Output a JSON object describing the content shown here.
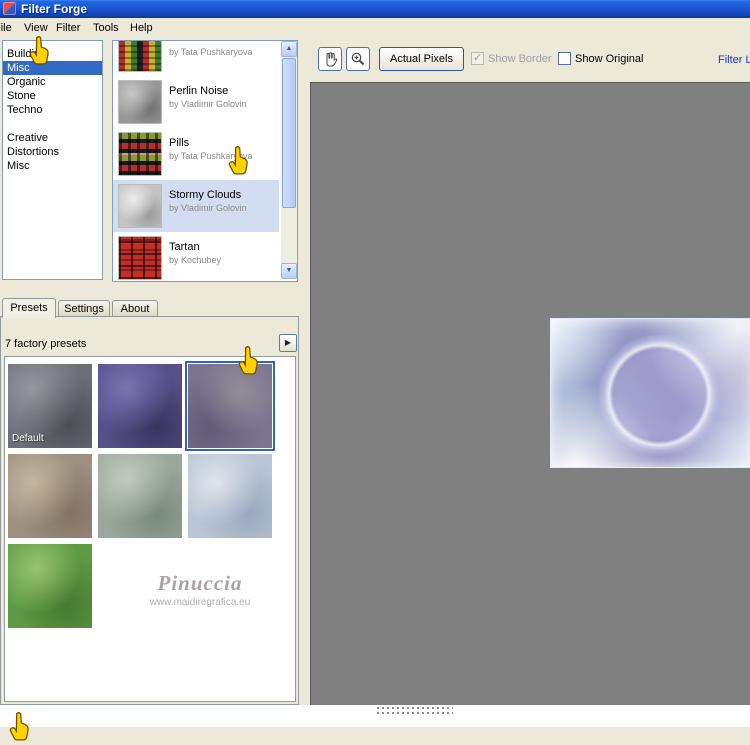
{
  "window": {
    "title": "Filter Forge"
  },
  "menu": {
    "items": [
      "File",
      "View",
      "Filter",
      "Tools",
      "Help"
    ]
  },
  "sidebar": {
    "categories": [
      "Building",
      "Misc",
      "Organic",
      "Stone",
      "Techno",
      "Creative",
      "Distortions",
      "Misc"
    ],
    "selected_category": "Misc"
  },
  "filters": {
    "items": [
      {
        "name": "",
        "author": "by Tata Pushkaryova"
      },
      {
        "name": "Perlin Noise",
        "author": "by Vladimir Golovin"
      },
      {
        "name": "Pills",
        "author": "by Tata Pushkaryova"
      },
      {
        "name": "Stormy Clouds",
        "author": "by Vladimir Golovin"
      },
      {
        "name": "Tartan",
        "author": "by Kochubey"
      }
    ],
    "selected_filter": "Stormy Clouds"
  },
  "tabs": {
    "items": [
      "Presets",
      "Settings",
      "About"
    ],
    "active": "Presets"
  },
  "presets": {
    "count_label": "7 factory presets",
    "default_label": "Default",
    "selected_index": 3,
    "watermark": {
      "line1": "Pinuccia",
      "line2": "www.maidiregrafica.eu"
    }
  },
  "toolbar": {
    "actual_pixels": "Actual Pixels",
    "show_border": "Show Border",
    "show_border_checked": true,
    "show_original": "Show Original",
    "show_original_checked": false,
    "filter_library": "Filter Li"
  },
  "colors": {
    "selection": "#316AC5",
    "titlebar": "#1C57D2",
    "link": "#2233CC",
    "preview_background": "#808080",
    "cursor_yellow": "#FFD200"
  }
}
